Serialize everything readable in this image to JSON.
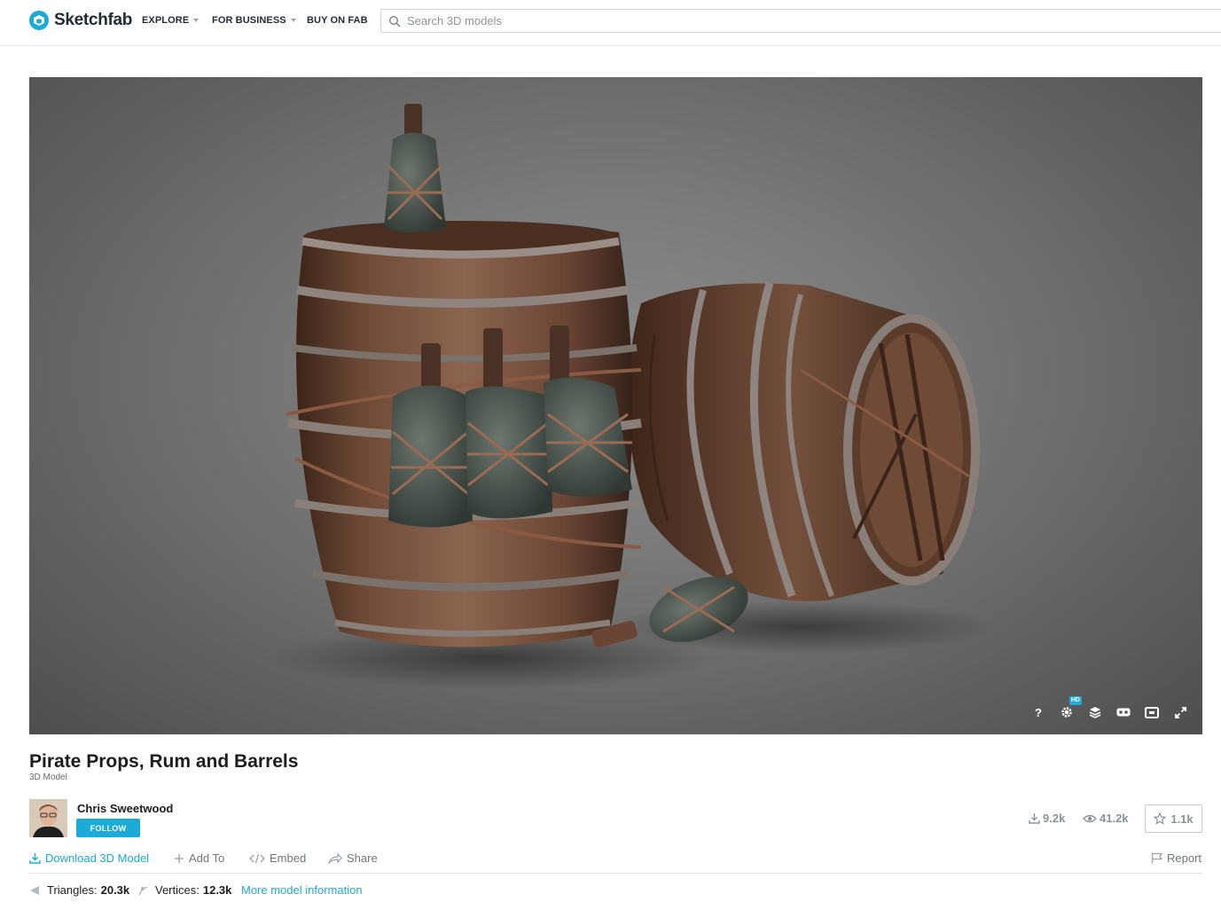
{
  "brand": {
    "name": "Sketchfab"
  },
  "nav": {
    "explore": "EXPLORE",
    "for_business": "FOR BUSINESS",
    "buy_on_fab": "BUY ON FAB"
  },
  "search": {
    "placeholder": "Search 3D models"
  },
  "viewer": {
    "controls": {
      "help": "?",
      "hd_badge": "HD"
    }
  },
  "model": {
    "title": "Pirate Props, Rum and Barrels",
    "type": "3D Model"
  },
  "author": {
    "name": "Chris Sweetwood",
    "follow_label": "FOLLOW"
  },
  "stats": {
    "downloads": "9.2k",
    "views": "41.2k",
    "likes": "1.1k"
  },
  "actions": {
    "download": "Download 3D Model",
    "add_to": "Add To",
    "embed": "Embed",
    "share": "Share",
    "report": "Report"
  },
  "model_info": {
    "triangles_label": "Triangles:",
    "triangles_value": "20.3k",
    "vertices_label": "Vertices:",
    "vertices_value": "12.3k",
    "more_link": "More model information"
  },
  "colors": {
    "accent": "#1caad9",
    "text_dark": "#1d1d1d",
    "muted": "#8a939a"
  },
  "icons": [
    "sketchfab-logo-icon",
    "search-icon",
    "help-icon",
    "settings-icon",
    "layers-icon",
    "vr-icon",
    "theater-mode-icon",
    "fullscreen-icon",
    "download-icon",
    "eye-icon",
    "star-icon",
    "plus-icon",
    "code-icon",
    "share-icon",
    "flag-icon",
    "triangle-icon",
    "vertex-icon"
  ]
}
